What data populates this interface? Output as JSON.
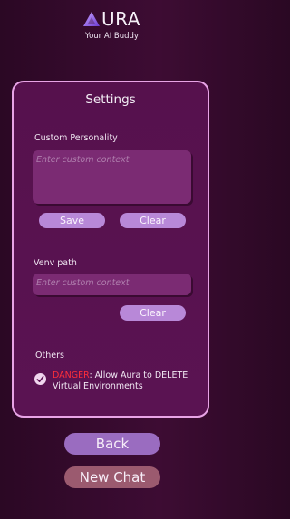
{
  "app": {
    "title": "URA",
    "tagline": "Your AI Buddy"
  },
  "settings": {
    "title": "Settings",
    "custom_personality": {
      "label": "Custom Personality",
      "placeholder": "Enter custom context",
      "save_label": "Save",
      "clear_label": "Clear"
    },
    "venv_path": {
      "label": "Venv path",
      "placeholder": "Enter custom context",
      "clear_label": "Clear"
    },
    "others": {
      "label": "Others",
      "danger_prefix": "DANGER",
      "danger_text": ": Allow Aura to DELETE Virtual Environments",
      "checked": true
    }
  },
  "footer": {
    "back_label": "Back",
    "new_chat_label": "New Chat"
  },
  "colors": {
    "panel_border": "#e8a4e6",
    "pill": "#b888d8",
    "danger": "#ff2e3a",
    "back_button": "#9a6cc0",
    "new_chat_button": "#9b5a6f"
  }
}
